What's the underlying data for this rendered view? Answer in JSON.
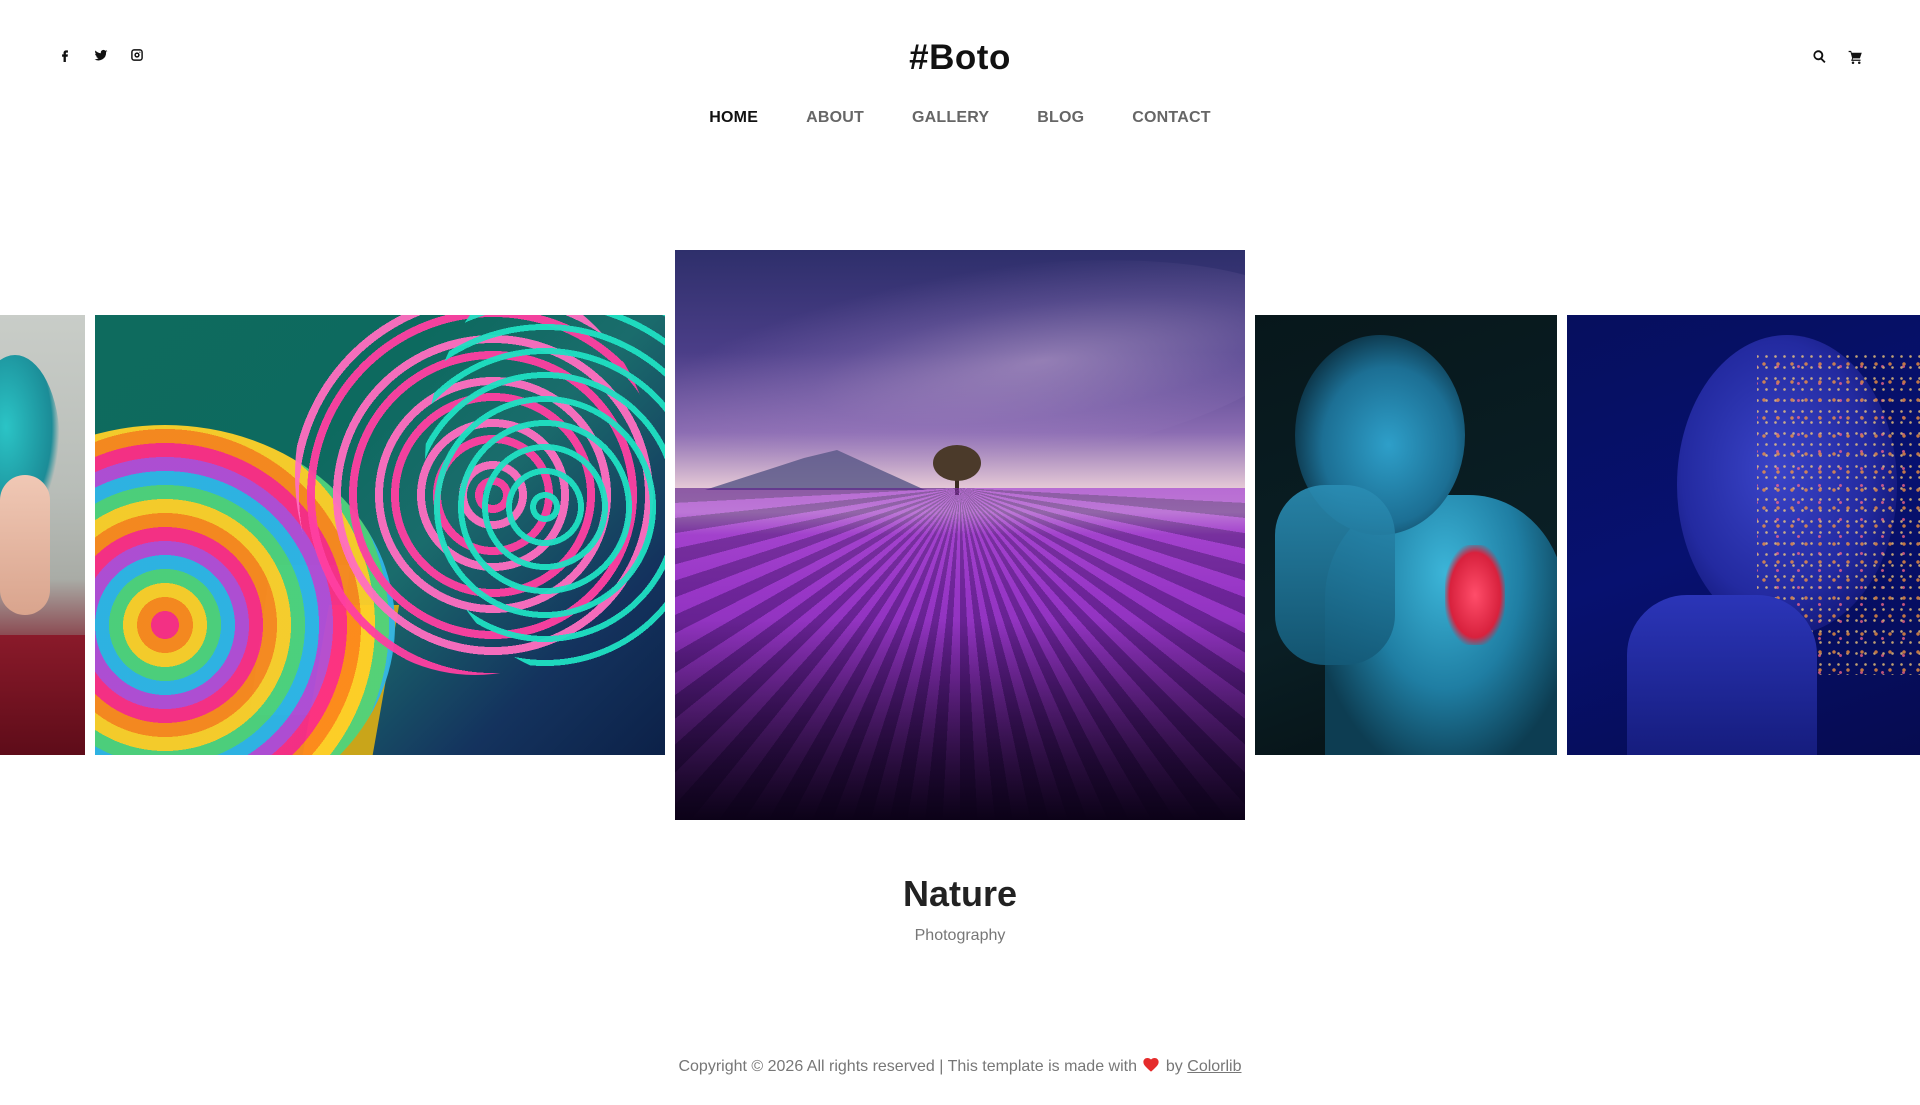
{
  "header": {
    "logo": "#Boto",
    "social_icons": [
      "facebook-icon",
      "twitter-icon",
      "instagram-icon"
    ],
    "tool_icons": [
      "search-icon",
      "cart-icon"
    ]
  },
  "nav": {
    "items": [
      {
        "label": "HOME",
        "active": true
      },
      {
        "label": "ABOUT",
        "active": false
      },
      {
        "label": "GALLERY",
        "active": false
      },
      {
        "label": "BLOG",
        "active": false
      },
      {
        "label": "CONTACT",
        "active": false
      }
    ],
    "active_underline_color": "#86c440"
  },
  "gallery": {
    "slides": [
      "portrait-teal-hair",
      "rainbow-slinky",
      "lavender-field",
      "blue-painted-man",
      "woman-with-glitter"
    ],
    "active_index": 2
  },
  "caption": {
    "title": "Nature",
    "subtitle": "Photography"
  },
  "footer": {
    "text_before": "Copyright © 2026 All rights reserved | This template is made with",
    "text_by": "by",
    "link": "Colorlib",
    "heart_color": "#e52b2b"
  }
}
